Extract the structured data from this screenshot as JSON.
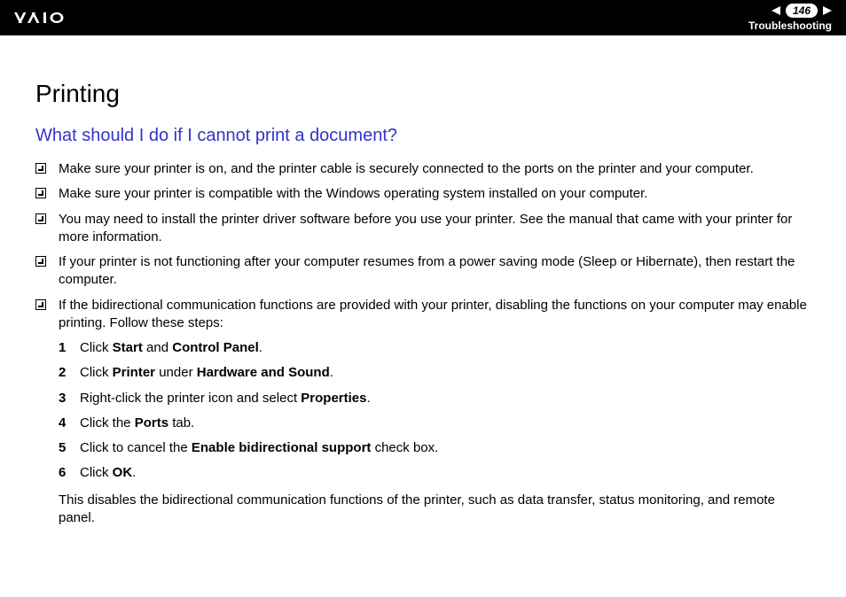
{
  "header": {
    "page_number": "146",
    "label": "Troubleshooting"
  },
  "content": {
    "title": "Printing",
    "subtitle": "What should I do if I cannot print a document?",
    "bullets": [
      "Make sure your printer is on, and the printer cable is securely connected to the ports on the printer and your computer.",
      "Make sure your printer is compatible with the Windows operating system installed on your computer.",
      "You may need to install the printer driver software before you use your printer. See the manual that came with your printer for more information.",
      "If your printer is not functioning after your computer resumes from a power saving mode (Sleep or Hibernate), then restart the computer.",
      "If the bidirectional communication functions are provided with your printer, disabling the functions on your computer may enable printing. Follow these steps:"
    ],
    "steps": {
      "s1": {
        "num": "1",
        "prefix": "Click ",
        "b1": "Start",
        "mid": " and ",
        "b2": "Control Panel",
        "suffix": "."
      },
      "s2": {
        "num": "2",
        "prefix": "Click ",
        "b1": "Printer",
        "mid": " under ",
        "b2": "Hardware and Sound",
        "suffix": "."
      },
      "s3": {
        "num": "3",
        "prefix": "Right-click the printer icon and select ",
        "b1": "Properties",
        "suffix": "."
      },
      "s4": {
        "num": "4",
        "prefix": "Click the ",
        "b1": "Ports",
        "suffix": " tab."
      },
      "s5": {
        "num": "5",
        "prefix": "Click to cancel the ",
        "b1": "Enable bidirectional support",
        "suffix": " check box."
      },
      "s6": {
        "num": "6",
        "prefix": "Click ",
        "b1": "OK",
        "suffix": "."
      }
    },
    "after_steps": "This disables the bidirectional communication functions of the printer, such as data transfer, status monitoring, and remote panel."
  }
}
